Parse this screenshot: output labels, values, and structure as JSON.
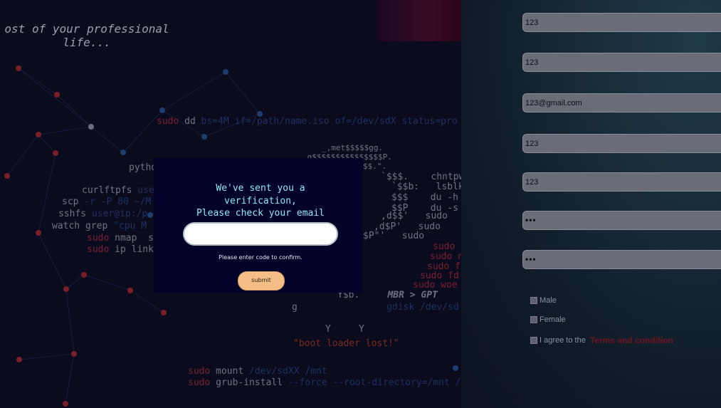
{
  "background": {
    "tagline": "ost of your professional\nlife...",
    "terminal_lines": {
      "dd_sudo": "sudo",
      "dd_cmd": "dd",
      "dd_args": "bs=4M if=/path/name.iso of=/dev/sdX status=pro",
      "python": "pytho",
      "curlftpfs": "curlftpfs",
      "curlftpfs_user": "use",
      "scp": "scp",
      "scp_args": "-r -P 80 ~/M",
      "sshfs": "sshfs",
      "sshfs_args": "user@ip:/p",
      "watch": "watch grep",
      "watch_args": "\"cpu M",
      "nmap_sudo": "sudo",
      "nmap": "nmap  s",
      "ip_sudo": "sudo",
      "ip": "ip link",
      "art1": "_,met$$$$$gg.",
      "art2": ",g$$$$$$$$$$$$$$$P.",
      "art3": "$$.\".",
      "art4": "`$$$.    chntpw -",
      "art5": "`$$b:   lsblk",
      "art6": "$$$    du -h",
      "art7": "$$P    du -s",
      "art8": ",d$$'   sudo",
      "art9": ",d$P'   sudo",
      "art10": "$P\"'   sudo",
      "art11": "sudo",
      "art12": "sudo n",
      "art13": "sudo f",
      "art14": "sudo fd",
      "art15": "sudo woe",
      "mbr_left": "Y$b.",
      "mbr": "MBR > GPT",
      "gdisk_g": "g",
      "gdisk": "gdisk /dev/sd",
      "yy": "Y     Y",
      "bootloader": "\"boot loader lost!\"",
      "mount_sudo": "sudo",
      "mount": "mount",
      "mount_args": "/dev/sdXX /mnt",
      "grub_sudo": "sudo",
      "grub": "grub-install",
      "grub_args": "--force --root-directory=/mnt /"
    }
  },
  "form": {
    "fields": [
      {
        "value": "123"
      },
      {
        "value": "123"
      },
      {
        "value": "123@gmail.com"
      },
      {
        "value": "123"
      },
      {
        "value": "123"
      },
      {
        "value": "•••"
      },
      {
        "value": "•••"
      }
    ],
    "gender_male": "Male",
    "gender_female": "Female",
    "agree_text": "I agree to the",
    "terms_link": "Terms and condition"
  },
  "modal": {
    "title": "We've sent you a\nverification,\nPlease check your email",
    "code_value": "",
    "hint": "Please enter code to confirm.",
    "submit_label": "submit"
  },
  "colors": {
    "modal_bg": "#03032a",
    "modal_title": "#8fe8f4",
    "submit_bg": "#f3bf86",
    "terms_link": "#6e1420"
  }
}
